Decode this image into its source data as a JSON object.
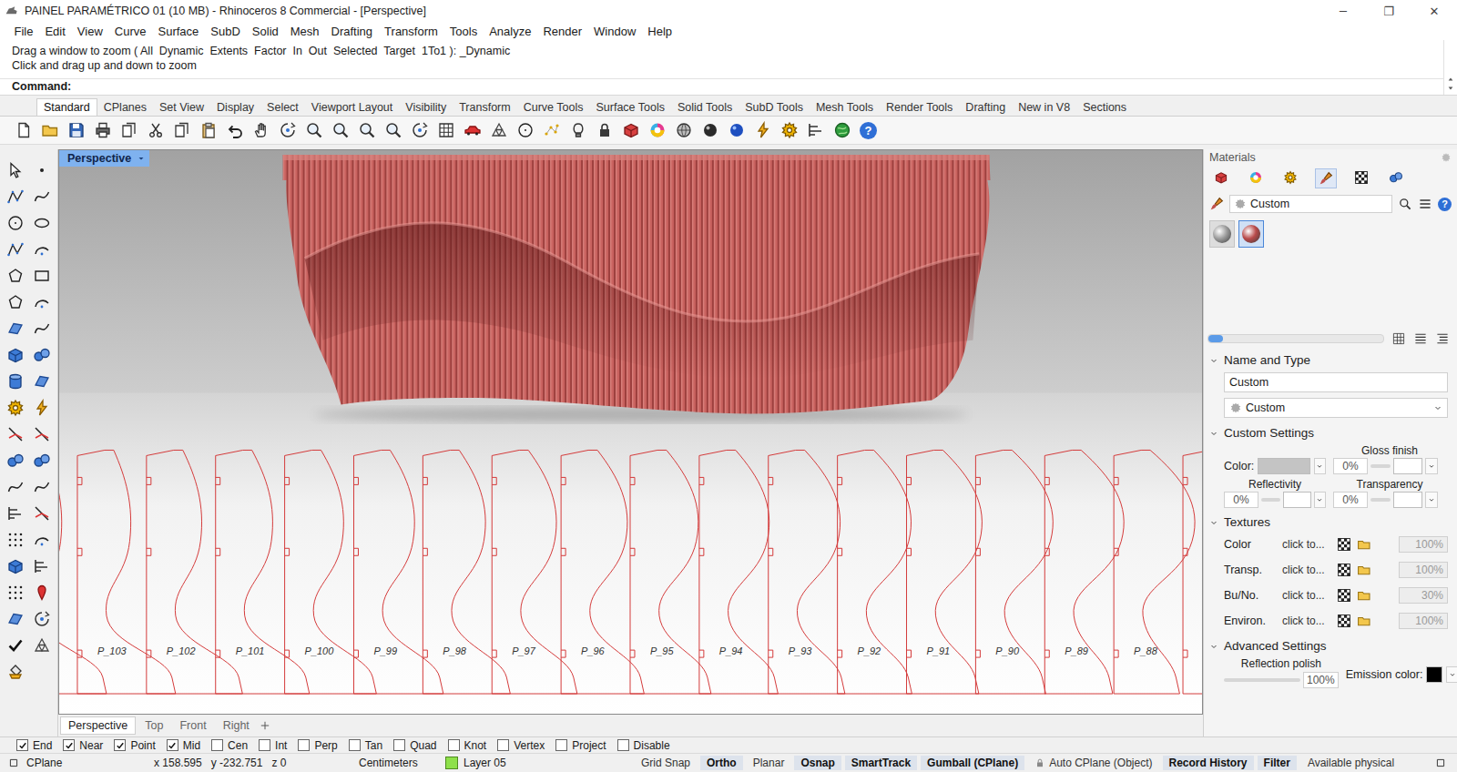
{
  "window": {
    "title": "PAINEL PARAMÉTRICO 01 (10 MB) - Rhinoceros 8 Commercial - [Perspective]",
    "controls": [
      "─",
      "❐",
      "✕"
    ]
  },
  "menu": [
    "File",
    "Edit",
    "View",
    "Curve",
    "Surface",
    "SubD",
    "Solid",
    "Mesh",
    "Drafting",
    "Transform",
    "Tools",
    "Analyze",
    "Render",
    "Window",
    "Help"
  ],
  "command": {
    "history": [
      "Drag a window to zoom ( All  Dynamic  Extents  Factor  In  Out  Selected  Target  1To1 ): _Dynamic",
      "Click and drag up and down to zoom"
    ],
    "prompt": "Command:"
  },
  "toolbar_tabs": [
    {
      "label": "Standard",
      "selected": true
    },
    {
      "label": "CPlanes",
      "selected": false
    },
    {
      "label": "Set View",
      "selected": false
    },
    {
      "label": "Display",
      "selected": false
    },
    {
      "label": "Select",
      "selected": false
    },
    {
      "label": "Viewport Layout",
      "selected": false
    },
    {
      "label": "Visibility",
      "selected": false
    },
    {
      "label": "Transform",
      "selected": false
    },
    {
      "label": "Curve Tools",
      "selected": false
    },
    {
      "label": "Surface Tools",
      "selected": false
    },
    {
      "label": "Solid Tools",
      "selected": false
    },
    {
      "label": "SubD Tools",
      "selected": false
    },
    {
      "label": "Mesh Tools",
      "selected": false
    },
    {
      "label": "Render Tools",
      "selected": false
    },
    {
      "label": "Drafting",
      "selected": false
    },
    {
      "label": "New in V8",
      "selected": false
    },
    {
      "label": "Sections",
      "selected": false
    }
  ],
  "help_glyph": "?",
  "viewport": {
    "title": "Perspective",
    "profiles": [
      "P_103",
      "P_102",
      "P_101",
      "P_100",
      "P_99",
      "P_98",
      "P_97",
      "P_96",
      "P_95",
      "P_94",
      "P_93",
      "P_92",
      "P_91",
      "P_90",
      "P_89",
      "P_88"
    ]
  },
  "viewport_tabs": [
    {
      "label": "Perspective",
      "selected": true
    },
    {
      "label": "Top",
      "selected": false
    },
    {
      "label": "Front",
      "selected": false
    },
    {
      "label": "Right",
      "selected": false
    }
  ],
  "materials": {
    "title": "Materials",
    "tabs": [
      {
        "selected": false
      },
      {
        "selected": false
      },
      {
        "selected": false
      },
      {
        "selected": true
      },
      {
        "selected": false
      },
      {
        "selected": false
      }
    ],
    "filter": "Custom",
    "swatches": [
      {
        "color": "#9c9c9c",
        "selected": false
      },
      {
        "color": "#b94a4a",
        "selected": true
      }
    ],
    "name_type": {
      "title": "Name and Type",
      "name": "Custom",
      "type": "Custom"
    },
    "custom": {
      "title": "Custom Settings",
      "color_label": "Color:",
      "gloss_label": "Gloss finish",
      "gloss": "0%",
      "reflectivity_label": "Reflectivity",
      "reflectivity": "0%",
      "transparency_label": "Transparency",
      "transparency": "0%"
    },
    "textures": {
      "title": "Textures",
      "rows": [
        {
          "label": "Color",
          "action": "click to...",
          "amount": "100%",
          "disabled": true
        },
        {
          "label": "Transp.",
          "action": "click to...",
          "amount": "100%",
          "disabled": true
        },
        {
          "label": "Bu/No.",
          "action": "click to...",
          "amount": "30%",
          "disabled": true
        },
        {
          "label": "Environ.",
          "action": "click to...",
          "amount": "100%",
          "disabled": true
        }
      ]
    },
    "advanced": {
      "title": "Advanced Settings",
      "polish_label": "Reflection polish",
      "polish": "100%",
      "emission_label": "Emission color:"
    }
  },
  "osnaps": [
    {
      "label": "End",
      "checked": true
    },
    {
      "label": "Near",
      "checked": true
    },
    {
      "label": "Point",
      "checked": true
    },
    {
      "label": "Mid",
      "checked": true
    },
    {
      "label": "Cen",
      "checked": false
    },
    {
      "label": "Int",
      "checked": false
    },
    {
      "label": "Perp",
      "checked": false
    },
    {
      "label": "Tan",
      "checked": false
    },
    {
      "label": "Quad",
      "checked": false
    },
    {
      "label": "Knot",
      "checked": false
    },
    {
      "label": "Vertex",
      "checked": false
    },
    {
      "label": "Project",
      "checked": false
    },
    {
      "label": "Disable",
      "checked": false
    }
  ],
  "status": {
    "cplane": "CPlane",
    "coords": "x 158.595   y -232.751   z 0",
    "units": "Centimeters",
    "layer": "Layer 05",
    "toggles": [
      {
        "label": "Grid Snap",
        "on": false,
        "locked": false
      },
      {
        "label": "Ortho",
        "on": true,
        "locked": false
      },
      {
        "label": "Planar",
        "on": false,
        "locked": false
      },
      {
        "label": "Osnap",
        "on": true,
        "locked": false
      },
      {
        "label": "SmartTrack",
        "on": true,
        "locked": false
      },
      {
        "label": "Gumball (CPlane)",
        "on": true,
        "locked": false
      },
      {
        "label": "Auto CPlane (Object)",
        "on": false,
        "locked": true
      },
      {
        "label": "Record History",
        "on": true,
        "locked": false
      },
      {
        "label": "Filter",
        "on": true,
        "locked": false
      }
    ],
    "memory": "Available physical"
  }
}
